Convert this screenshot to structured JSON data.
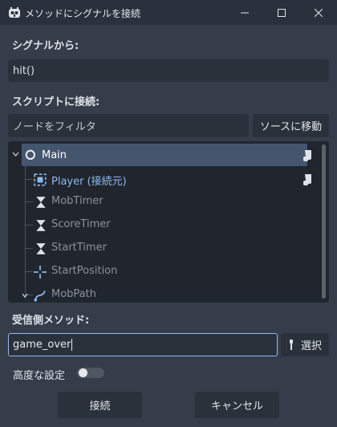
{
  "window": {
    "title": "メソッドにシグナルを接続",
    "minimize_icon": "minimize-icon",
    "maximize_icon": "maximize-icon",
    "close_icon": "close-icon"
  },
  "signal_section": {
    "label": "シグナルから:",
    "value": "hit()"
  },
  "script_section": {
    "label": "スクリプトに接続:",
    "filter_placeholder": "ノードをフィルタ",
    "goto_source_button": "ソースに移動"
  },
  "tree": {
    "items": [
      {
        "label": "Main",
        "icon": "node2d-circle-icon",
        "selected": true,
        "has_script": true,
        "expanded": true
      },
      {
        "label": "Player (接続元)",
        "icon": "area2d-icon",
        "source": true,
        "has_script": true
      },
      {
        "label": "MobTimer",
        "icon": "timer-icon",
        "disabled": true
      },
      {
        "label": "ScoreTimer",
        "icon": "timer-icon",
        "disabled": true
      },
      {
        "label": "StartTimer",
        "icon": "timer-icon",
        "disabled": true
      },
      {
        "label": "StartPosition",
        "icon": "marker2d-icon",
        "disabled": true
      },
      {
        "label": "MobPath",
        "icon": "path2d-icon",
        "disabled": true,
        "expanded": true
      }
    ]
  },
  "receiver_section": {
    "label": "受信側メソッド:",
    "method_value": "game_over",
    "pick_button": "選択"
  },
  "advanced": {
    "label": "高度な設定",
    "enabled": false
  },
  "footer": {
    "connect_button": "接続",
    "cancel_button": "キャンセル"
  },
  "colors": {
    "background": "#363d4a",
    "titlebar": "#2a313c",
    "field": "#2b313b",
    "tree_bg": "#21262e",
    "selection": "#44556e",
    "accent_blue": "#8fb9ee",
    "disabled_text": "#8b919b"
  }
}
